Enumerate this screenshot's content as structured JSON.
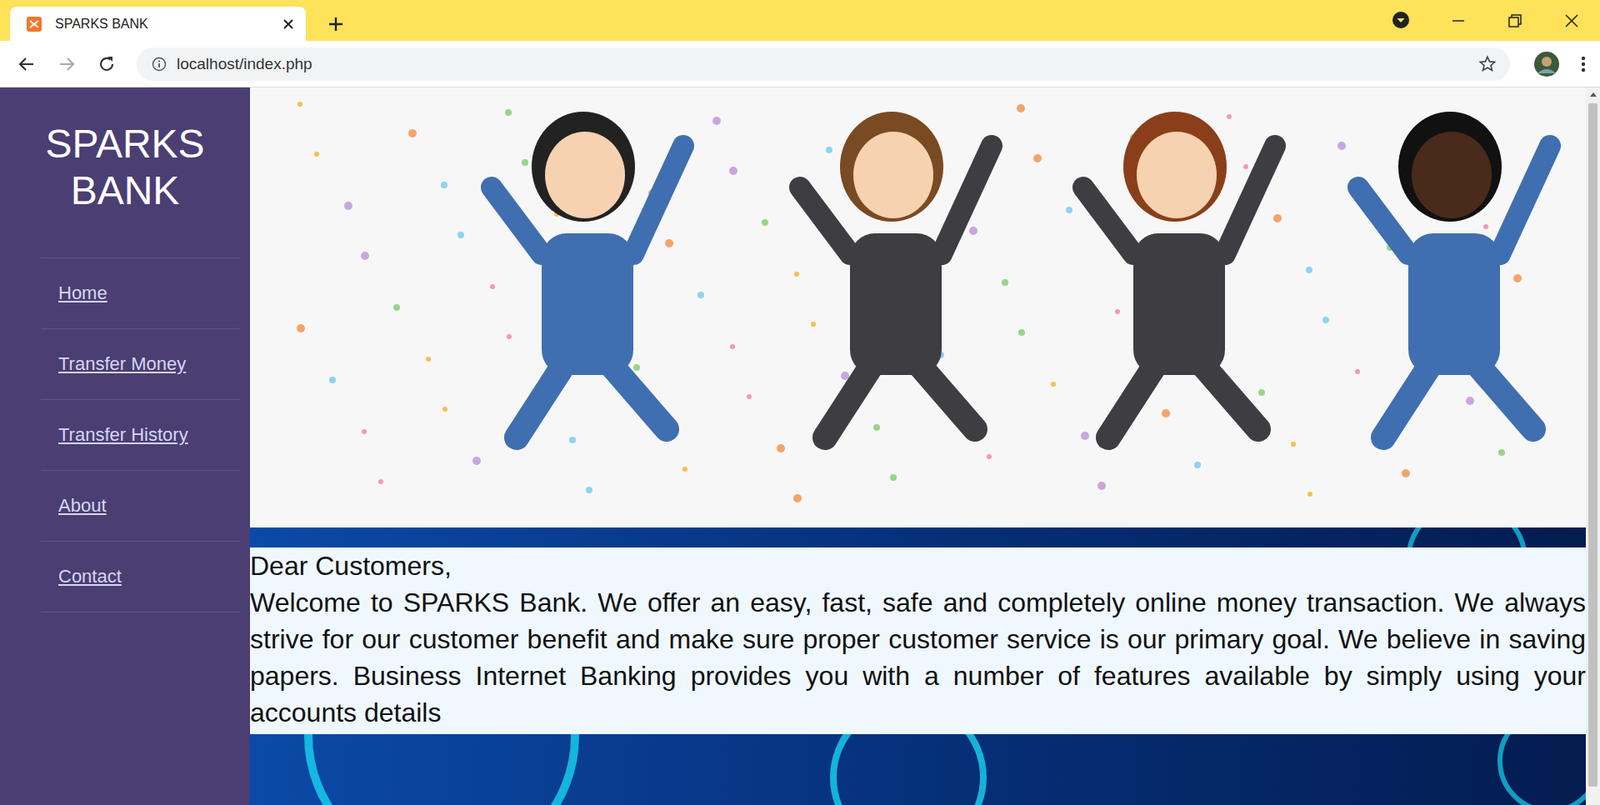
{
  "window": {
    "tab_title": "SPARKS BANK",
    "address": "localhost/index.php"
  },
  "sidebar": {
    "brand": "SPARKS BANK",
    "items": [
      {
        "label": "Home",
        "selected": false
      },
      {
        "label": "Transfer Money",
        "selected": false
      },
      {
        "label": "Transfer History",
        "selected": false
      },
      {
        "label": "About",
        "selected": false
      },
      {
        "label": "Contact",
        "selected": false
      }
    ]
  },
  "welcome": {
    "greeting": "Dear Customers,",
    "body": "Welcome to SPARKS Bank. We offer an easy, fast, safe and completely online money transaction. We always strive for our customer benefit and make sure proper customer service is our primary goal. We believe in saving papers. Business Internet Banking provides you with a number of features available by simply using your accounts details"
  }
}
